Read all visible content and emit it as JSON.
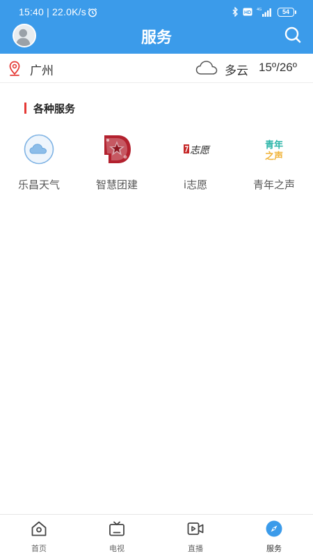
{
  "status_bar": {
    "time": "15:40 | 22.0K/s",
    "battery": "54",
    "hd": "HD",
    "network": "4G"
  },
  "header": {
    "title": "服务",
    "avatar_icon": "user-avatar",
    "search_icon": "search-icon"
  },
  "weather": {
    "city": "广州",
    "condition": "多云",
    "temperature": "15º/26º",
    "location_icon": "location-pin-icon",
    "condition_icon": "cloud-icon"
  },
  "section": {
    "title": "各种服务",
    "marker_color": "#e53935"
  },
  "services": [
    {
      "label": "乐昌天气",
      "icon": "weather-cloud-icon"
    },
    {
      "label": "智慧团建",
      "icon": "youth-league-icon"
    },
    {
      "label": "i志愿",
      "icon": "volunteer-icon",
      "logo_text": "志愿"
    },
    {
      "label": "青年之声",
      "icon": "youth-voice-icon",
      "logo_text": [
        "青年",
        "之声"
      ]
    }
  ],
  "bottom_nav": [
    {
      "label": "首页",
      "icon": "home-icon",
      "active": false
    },
    {
      "label": "电视",
      "icon": "tv-icon",
      "active": false
    },
    {
      "label": "直播",
      "icon": "live-video-icon",
      "active": false
    },
    {
      "label": "服务",
      "icon": "compass-icon",
      "active": true
    }
  ],
  "colors": {
    "primary": "#3b9bea",
    "text": "#333333",
    "muted": "#555555",
    "accent_red": "#e53935"
  }
}
